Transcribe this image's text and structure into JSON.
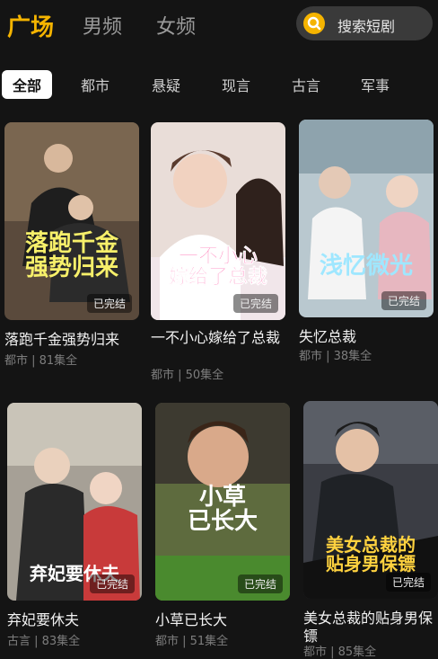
{
  "top_tabs": [
    "广场",
    "男频",
    "女频"
  ],
  "search": {
    "label": "搜索短剧"
  },
  "categories": [
    "全部",
    "都市",
    "悬疑",
    "现言",
    "古言",
    "军事"
  ],
  "cards": [
    {
      "poster_title": "落跑千金\n强势归来",
      "badge": "已完结",
      "title": "落跑千金强势归来",
      "meta": "都市 | 81集全"
    },
    {
      "poster_title": "一不小心\n嫁给了总裁",
      "badge": "已完结",
      "title": "一不小心嫁给了总裁",
      "meta": "都市 | 50集全"
    },
    {
      "poster_title": "浅忆微光",
      "badge": "已完结",
      "title": "失忆总裁",
      "meta": "都市 | 38集全"
    },
    {
      "poster_title": "弃妃要休夫",
      "badge": "已完结",
      "title": "弃妃要休夫",
      "meta": "古言 | 83集全"
    },
    {
      "poster_title": "小草\n已长大",
      "badge": "已完结",
      "title": "小草已长大",
      "meta": "都市 | 51集全"
    },
    {
      "poster_title": "美女总裁的\n贴身男保镖",
      "badge": "已完结",
      "title": "美女总裁的贴身男保镖",
      "meta": "都市 | 85集全"
    }
  ],
  "colors": {
    "accent": "#f5b400",
    "background": "#141414"
  }
}
